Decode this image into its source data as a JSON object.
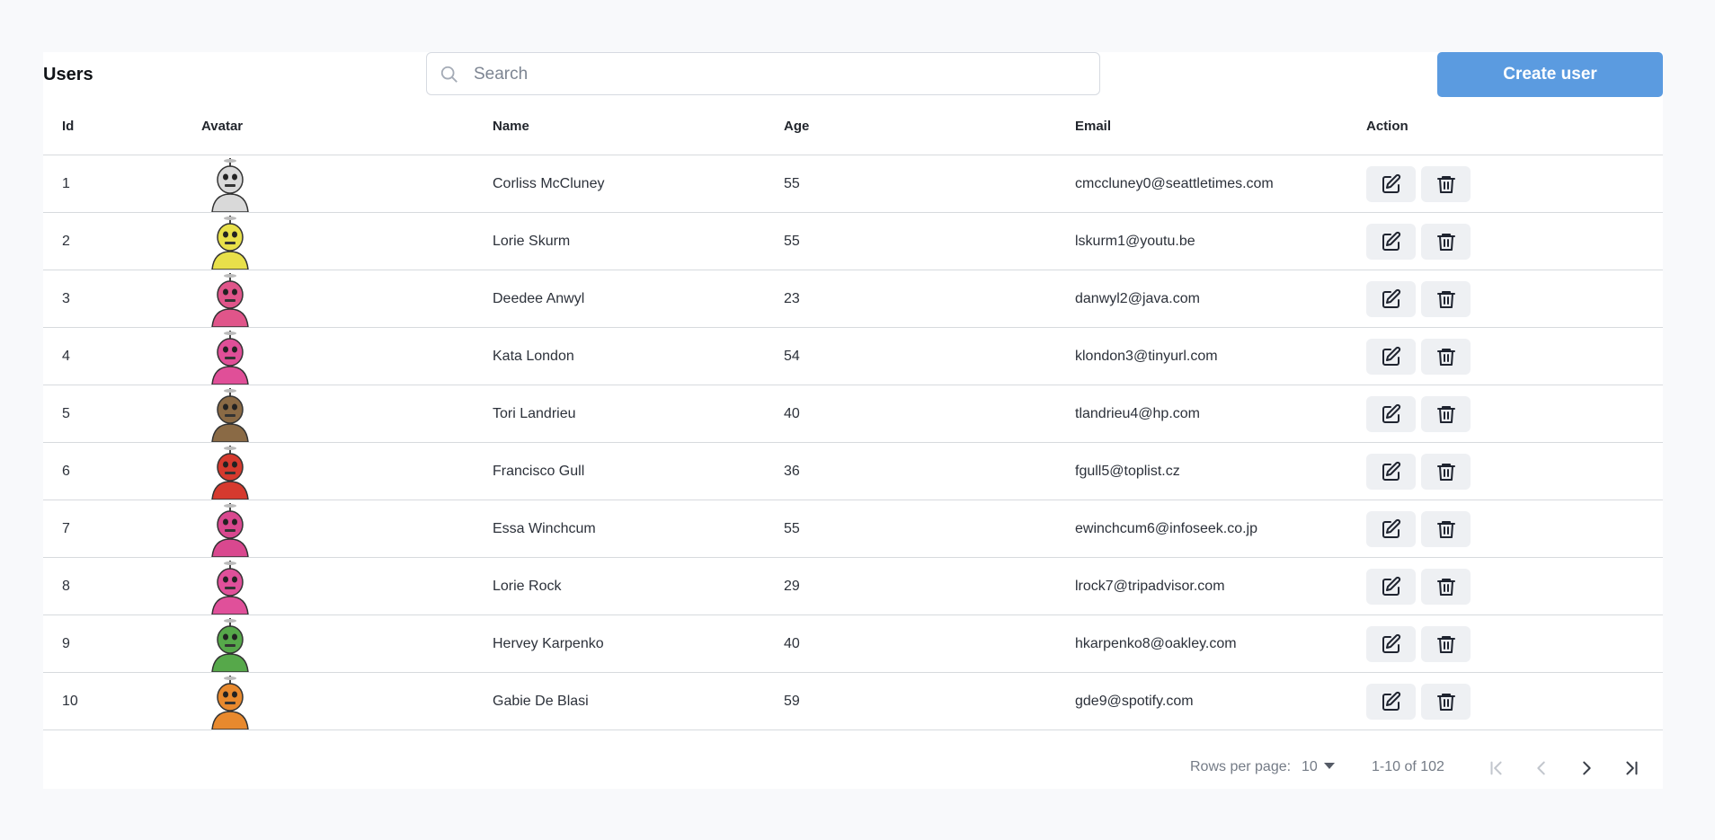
{
  "header": {
    "title": "Users",
    "search_placeholder": "Search",
    "search_value": "",
    "create_label": "Create user"
  },
  "table": {
    "columns": [
      "Id",
      "Avatar",
      "Name",
      "Age",
      "Email",
      "Action"
    ],
    "rows": [
      {
        "id": "1",
        "name": "Corliss McCluney",
        "age": "55",
        "email": "cmccluney0@seattletimes.com",
        "avatar_color": "#d9d9d9"
      },
      {
        "id": "2",
        "name": "Lorie Skurm",
        "age": "55",
        "email": "lskurm1@youtu.be",
        "avatar_color": "#e8e04a"
      },
      {
        "id": "3",
        "name": "Deedee Anwyl",
        "age": "23",
        "email": "danwyl2@java.com",
        "avatar_color": "#e0558a"
      },
      {
        "id": "4",
        "name": "Kata London",
        "age": "54",
        "email": "klondon3@tinyurl.com",
        "avatar_color": "#e04f98"
      },
      {
        "id": "5",
        "name": "Tori Landrieu",
        "age": "40",
        "email": "tlandrieu4@hp.com",
        "avatar_color": "#8a6a45"
      },
      {
        "id": "6",
        "name": "Francisco Gull",
        "age": "36",
        "email": "fgull5@toplist.cz",
        "avatar_color": "#d63a2e"
      },
      {
        "id": "7",
        "name": "Essa Winchcum",
        "age": "55",
        "email": "ewinchcum6@infoseek.co.jp",
        "avatar_color": "#d9488f"
      },
      {
        "id": "8",
        "name": "Lorie Rock",
        "age": "29",
        "email": "lrock7@tripadvisor.com",
        "avatar_color": "#e0509a"
      },
      {
        "id": "9",
        "name": "Hervey Karpenko",
        "age": "40",
        "email": "hkarpenko8@oakley.com",
        "avatar_color": "#56a84a"
      },
      {
        "id": "10",
        "name": "Gabie De Blasi",
        "age": "59",
        "email": "gde9@spotify.com",
        "avatar_color": "#e8892e"
      }
    ]
  },
  "pagination": {
    "rows_per_page_label": "Rows per page:",
    "rows_per_page_value": "10",
    "range_text": "1-10 of 102"
  },
  "icons": {
    "search": "search-icon",
    "edit": "edit-icon",
    "delete": "trash-icon",
    "first": "first-page-icon",
    "prev": "chevron-left-icon",
    "next": "chevron-right-icon",
    "last": "last-page-icon"
  },
  "colors": {
    "accent": "#5b9be0",
    "action_bg": "#eef0f3",
    "page_bg": "#f8f9fb"
  }
}
